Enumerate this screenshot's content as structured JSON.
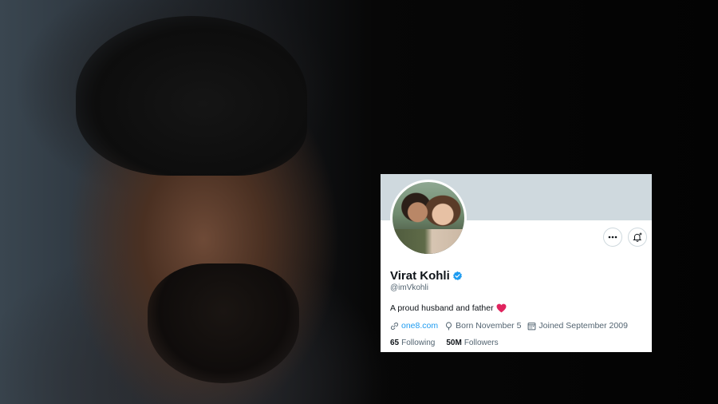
{
  "profile": {
    "name": "Virat Kohli",
    "handle": "@imVkohli",
    "bio": "A proud husband and father",
    "website": "one8.com",
    "born": "Born November 5",
    "joined": "Joined September 2009",
    "following_count": "65",
    "following_label": "Following",
    "followers_count": "50M",
    "followers_label": "Followers"
  },
  "icons": {
    "more": "more-options-icon",
    "notify": "notification-bell-icon",
    "verified": "verified-badge-icon",
    "heart": "heart-emoji",
    "link": "link-icon",
    "born": "birthday-balloon-icon",
    "joined": "calendar-icon"
  },
  "colors": {
    "verified": "#1d9bf0",
    "link": "#1d9bf0",
    "heart": "#e0245e",
    "banner": "#cfd9de"
  }
}
